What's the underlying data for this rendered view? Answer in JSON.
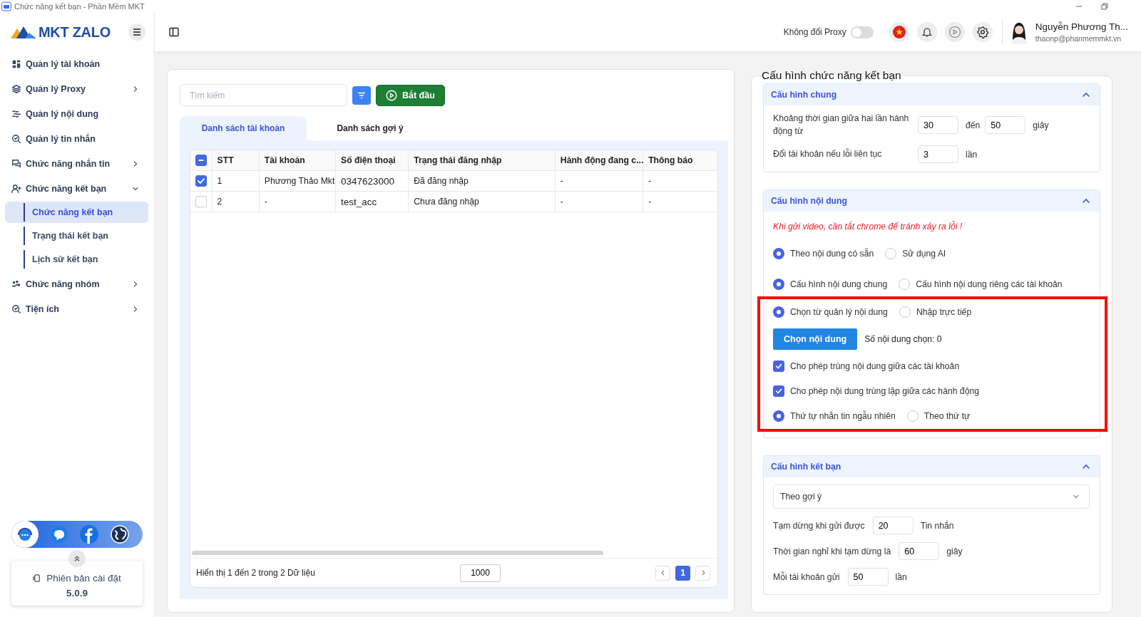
{
  "window": {
    "title": "Chức năng kết bạn - Phần Mềm MKT"
  },
  "header": {
    "logo": "MKT ZALO",
    "proxy_toggle": {
      "label": "Không đổi Proxy",
      "on": false
    },
    "user": {
      "name": "Nguyễn Phương Th...",
      "email": "thaonp@phanmemmkt.vn"
    }
  },
  "sidebar": {
    "items": [
      {
        "label": "Quản lý tài khoản"
      },
      {
        "label": "Quản lý Proxy",
        "expanded": false
      },
      {
        "label": "Quản lý nội dung"
      },
      {
        "label": "Quản lý tin nhắn"
      },
      {
        "label": "Chức năng nhắn tin",
        "expanded": false
      },
      {
        "label": "Chức năng kết bạn",
        "expanded": true,
        "children": [
          {
            "label": "Chức năng kết bạn",
            "selected": true
          },
          {
            "label": "Trạng thái kết bạn",
            "selected": false
          },
          {
            "label": "Lịch sử kết bạn",
            "selected": false
          }
        ]
      },
      {
        "label": "Chức năng nhóm",
        "expanded": false
      },
      {
        "label": "Tiện ích",
        "expanded": false
      }
    ],
    "version": {
      "label": "Phiên bản cài đặt",
      "number": "5.0.9"
    }
  },
  "toolbar": {
    "search_placeholder": "Tìm kiếm",
    "start_button": "Bắt đầu"
  },
  "tabs": [
    {
      "label": "Danh sách tài khoản",
      "selected": true
    },
    {
      "label": "Danh sách gợi ý",
      "selected": false
    }
  ],
  "table": {
    "header_checkbox": {
      "indeterminate": true
    },
    "columns": [
      "STT",
      "Tài khoản",
      "Số điện thoại",
      "Trạng thái đăng nhập",
      "Hành động đang c...",
      "Thông báo"
    ],
    "rows": [
      {
        "checked": true,
        "cells": [
          "1",
          "Phương Thảo Mkt",
          "0347623000",
          "Đã đăng nhập",
          "-",
          "-"
        ]
      },
      {
        "checked": false,
        "cells": [
          "2",
          "-",
          "test_acc",
          "Chưa đăng nhập",
          "-",
          "-"
        ]
      }
    ]
  },
  "footer": {
    "summary": "Hiển thị 1 đến 2 trong 2 Dữ liệu",
    "page_size": "1000",
    "pages": [
      {
        "label": "1",
        "selected": true
      }
    ]
  },
  "config": {
    "title": "Cấu hình chức năng kết bạn",
    "sections": [
      {
        "title": "Cấu hình chung",
        "expanded": true,
        "rows": [
          {
            "kind": "range",
            "label": "Khoảng thời gian giữa hai lần hành động từ",
            "from": "30",
            "separator": "đến",
            "to": "50",
            "unit": "giây",
            "highlighted": false
          },
          {
            "kind": "number",
            "label": "Đổi tài khoản nếu lỗi liên tục",
            "value": "3",
            "unit": "lần",
            "highlighted": false
          }
        ]
      },
      {
        "title": "Cấu hình nội dung",
        "expanded": true,
        "rows": [
          {
            "kind": "warning",
            "text": "Khi gửi video, cần tắt chrome để tránh xảy ra lỗi !",
            "highlighted": false
          },
          {
            "kind": "radio",
            "options": [
              {
                "label": "Theo nội dung có sẵn",
                "selected": true
              },
              {
                "label": "Sử dụng AI",
                "selected": false
              }
            ],
            "highlighted": false
          },
          {
            "kind": "radio",
            "options": [
              {
                "label": "Cấu hình nội dung chung",
                "selected": true
              },
              {
                "label": "Cấu hình nội dung riêng các tài khoản",
                "selected": false
              }
            ],
            "highlighted": false
          },
          {
            "kind": "radio",
            "options": [
              {
                "label": "Chọn từ quản lý nội dung",
                "selected": true
              },
              {
                "label": "Nhập trực tiếp",
                "selected": false
              }
            ],
            "highlighted": true
          },
          {
            "kind": "button",
            "button": "Chọn nội dung",
            "note": "Số nội dung chọn: 0",
            "highlighted": true
          },
          {
            "kind": "checkbox",
            "label": "Cho phép trùng nội dung giữa các tài khoản",
            "checked": true,
            "highlighted": true
          },
          {
            "kind": "checkbox",
            "label": "Cho phép nội dung trùng lặp giữa các hành động",
            "checked": true,
            "highlighted": true
          },
          {
            "kind": "radio",
            "options": [
              {
                "label": "Thứ tự nhắn tin ngẫu nhiên",
                "selected": true
              },
              {
                "label": "Theo thứ tự",
                "selected": false
              }
            ],
            "highlighted": true
          }
        ]
      },
      {
        "title": "Cấu hình kết bạn",
        "expanded": true,
        "rows": [
          {
            "kind": "select",
            "value": "Theo gợi ý",
            "highlighted": false
          },
          {
            "kind": "number",
            "label": "Tạm dừng khi gửi được",
            "value": "20",
            "unit": "Tin nhắn",
            "highlighted": false
          },
          {
            "kind": "number",
            "label": "Thời gian nghỉ khi tạm dừng là",
            "value": "60",
            "unit": "giây",
            "highlighted": false
          },
          {
            "kind": "number",
            "label": "Mỗi tài khoản gửi",
            "value": "50",
            "unit": "lần",
            "highlighted": false
          }
        ]
      }
    ]
  }
}
